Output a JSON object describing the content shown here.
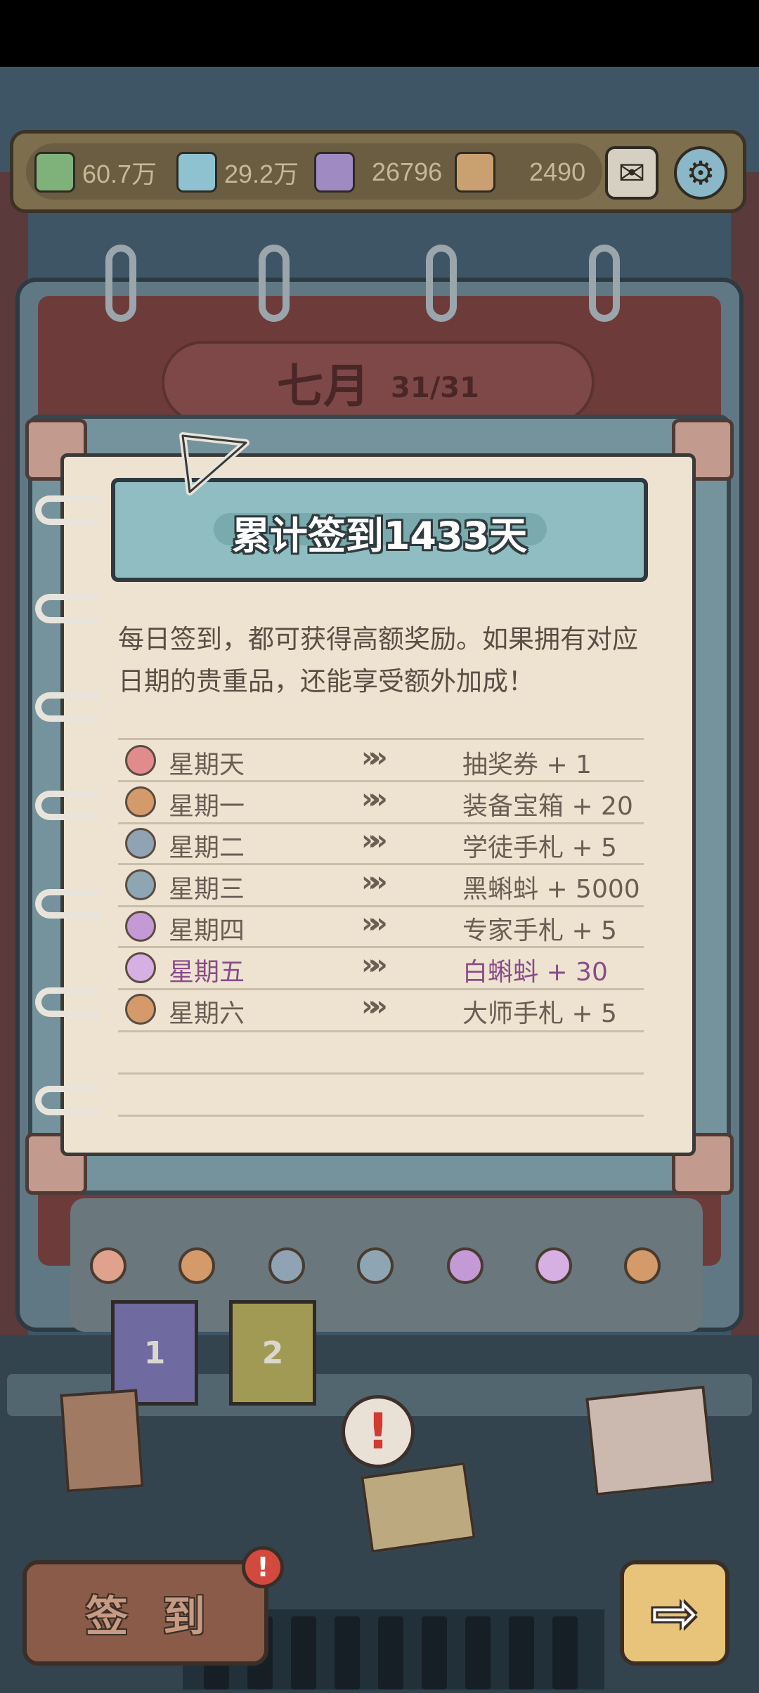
{
  "resources": [
    {
      "icon": "green-ink-bottle-icon",
      "value": "60.7万",
      "color": "#7fb27a"
    },
    {
      "icon": "blue-ink-bottle-icon",
      "value": "29.2万",
      "color": "#8ec2d0"
    },
    {
      "icon": "purple-ink-bottle-icon",
      "value": "26796",
      "color": "#9f8ac2"
    },
    {
      "icon": "brown-ink-bottle-icon",
      "value": "2490",
      "color": "#c9a070"
    }
  ],
  "calendar": {
    "month": "七月",
    "days": "31/31"
  },
  "popup": {
    "title": "累计签到1433天",
    "description": "每日签到，都可获得高额奖励。如果拥有对应日期的贵重品，还能享受额外加成！",
    "arrow_glyph": "»",
    "rows": [
      {
        "day": "星期天",
        "reward": "抽奖券 + 1",
        "icon": "ticket-icon",
        "icon_color": "#e08c8c",
        "active": false
      },
      {
        "day": "星期一",
        "reward": "装备宝箱 + 20",
        "icon": "chest-icon",
        "icon_color": "#d49a6a",
        "active": false
      },
      {
        "day": "星期二",
        "reward": "学徒手札 + 5",
        "icon": "scroll-icon",
        "icon_color": "#8fa3b5",
        "active": false
      },
      {
        "day": "星期三",
        "reward": "黑蝌蚪 + 5000",
        "icon": "black-tadpole-icon",
        "icon_color": "#8ea6b3",
        "active": false
      },
      {
        "day": "星期四",
        "reward": "专家手札 + 5",
        "icon": "expert-scroll-icon",
        "icon_color": "#c49ad6",
        "active": false
      },
      {
        "day": "星期五",
        "reward": "白蝌蚪 + 30",
        "icon": "white-tadpole-icon",
        "icon_color": "#d7b0e3",
        "active": true
      },
      {
        "day": "星期六",
        "reward": "大师手札 + 5",
        "icon": "master-scroll-icon",
        "icon_color": "#d49a6a",
        "active": false
      }
    ]
  },
  "bottom": {
    "tab1": "1",
    "tab2": "2",
    "alert_glyph": "!",
    "signin_label": "签到",
    "signin_badge": "!",
    "next_glyph": "⇨"
  }
}
